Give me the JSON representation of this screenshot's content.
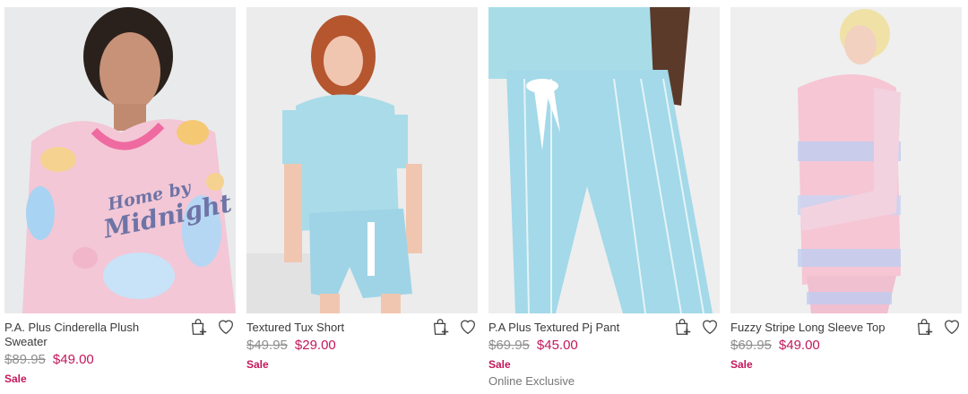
{
  "products": [
    {
      "name": "P.A. Plus Cinderella Plush Sweater",
      "original_price": "$89.95",
      "sale_price": "$49.00",
      "badge": "Sale",
      "exclusive": "",
      "image_print": [
        "Home by",
        "Midnight"
      ]
    },
    {
      "name": "Textured Tux Short",
      "original_price": "$49.95",
      "sale_price": "$29.00",
      "badge": "Sale",
      "exclusive": ""
    },
    {
      "name": "P.A Plus Textured Pj Pant",
      "original_price": "$69.95",
      "sale_price": "$45.00",
      "badge": "Sale",
      "exclusive": "Online Exclusive"
    },
    {
      "name": "Fuzzy Stripe Long Sleeve Top",
      "original_price": "$69.95",
      "sale_price": "$49.00",
      "badge": "Sale",
      "exclusive": ""
    }
  ],
  "icons": {
    "add_to_bag": "shopping-bag-plus-icon",
    "wishlist": "heart-outline-icon"
  },
  "colors": {
    "sale_price": "#c2185b",
    "original_price": "#8f8f8f",
    "product_name": "#3a3a3a",
    "exclusive": "#777777"
  }
}
